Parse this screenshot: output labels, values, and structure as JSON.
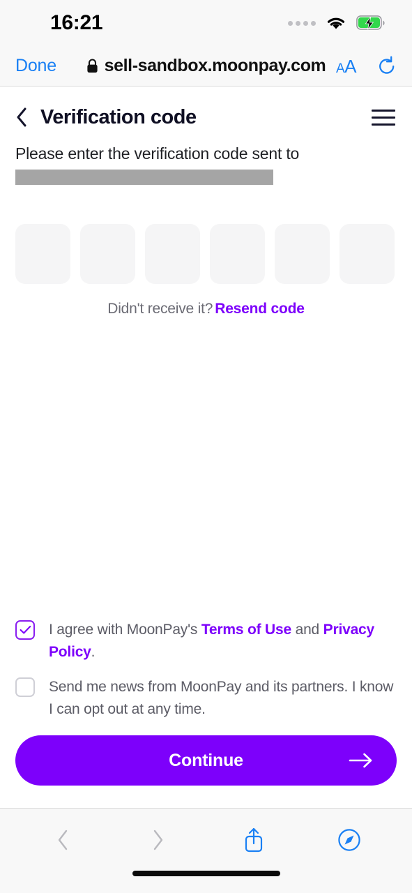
{
  "status_bar": {
    "time": "16:21",
    "signal_icon": "signal-dots-icon",
    "wifi_icon": "wifi-icon",
    "battery_icon": "battery-charging-icon",
    "battery_charging": true
  },
  "browser": {
    "done_label": "Done",
    "lock_icon": "lock-icon",
    "url": "sell-sandbox.moonpay.com",
    "text_size_label_small": "A",
    "text_size_label_big": "A",
    "reload_icon": "reload-icon",
    "toolbar": {
      "back_icon": "chevron-left-icon",
      "forward_icon": "chevron-right-icon",
      "share_icon": "share-up-icon",
      "tabs_icon": "safari-compass-icon"
    }
  },
  "page": {
    "back_icon": "chevron-left-icon",
    "title": "Verification code",
    "menu_icon": "hamburger-menu-icon",
    "subtitle": "Please enter the verification code sent to",
    "redacted_value": "",
    "otp": {
      "count": 6,
      "values": [
        "",
        "",
        "",
        "",
        "",
        ""
      ]
    },
    "resend": {
      "prompt": "Didn't receive it?",
      "link_label": "Resend code"
    },
    "consent": [
      {
        "checked": true,
        "check_icon": "checkmark-icon",
        "parts": [
          {
            "text": "I agree with MoonPay's ",
            "link": false
          },
          {
            "text": "Terms of Use",
            "link": true
          },
          {
            "text": " and ",
            "link": false
          },
          {
            "text": "Privacy Policy",
            "link": true
          },
          {
            "text": ".",
            "link": false
          }
        ]
      },
      {
        "checked": false,
        "check_icon": "",
        "parts": [
          {
            "text": "Send me news from MoonPay and its partners. I know I can opt out at any time.",
            "link": false
          }
        ]
      }
    ],
    "continue_label": "Continue",
    "continue_arrow_icon": "arrow-right-icon"
  },
  "colors": {
    "accent_purple": "#7d00fb",
    "link_blue": "#1a80f4",
    "otp_box_bg": "#f5f5f6",
    "redacted_gray": "#a5a5a5",
    "title_dark": "#0f0f23",
    "body_gray": "#5c5c66",
    "battery_green": "#32d74b"
  }
}
